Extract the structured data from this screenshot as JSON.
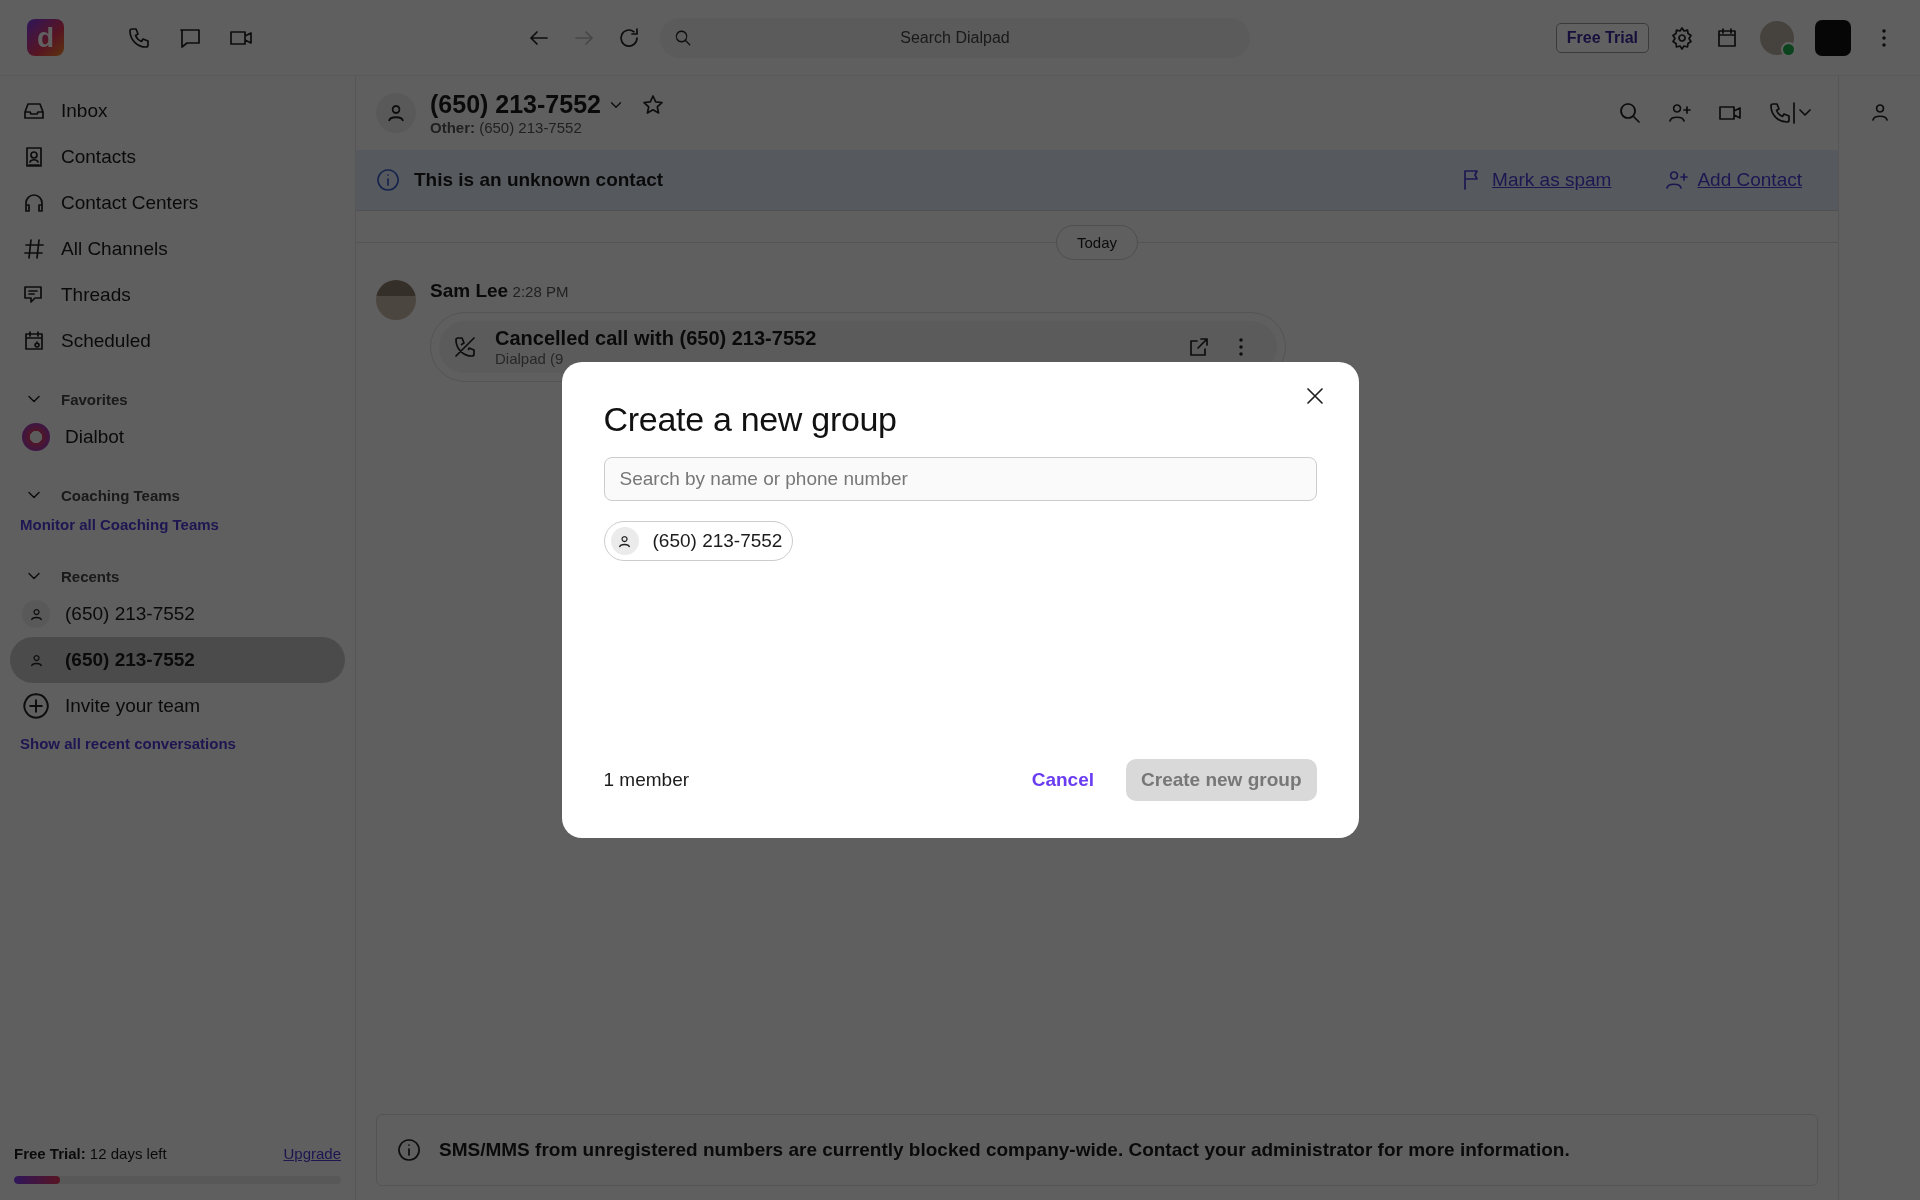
{
  "topbar": {
    "logo_letter": "d",
    "search": {
      "placeholder": "Search Dialpad"
    },
    "trial_button": "Free Trial"
  },
  "sidebar": {
    "nav": [
      {
        "label": "Inbox"
      },
      {
        "label": "Contacts"
      },
      {
        "label": "Contact Centers"
      },
      {
        "label": "All Channels"
      },
      {
        "label": "Threads"
      },
      {
        "label": "Scheduled"
      }
    ],
    "favorites": {
      "title": "Favorites",
      "expanded": true,
      "items": [
        {
          "label": "Dialbot"
        }
      ]
    },
    "coaching": {
      "title": "Coaching Teams",
      "expanded": true,
      "link": "Monitor all Coaching Teams"
    },
    "recents": {
      "title": "Recents",
      "expanded": true,
      "items": [
        {
          "label": "(650) 213-7552",
          "selected": false
        },
        {
          "label": "(650) 213-7552",
          "selected": true
        }
      ],
      "invite": "Invite your team",
      "link": "Show all recent conversations"
    },
    "trial": {
      "label": "Free Trial:",
      "remaining": "12 days left",
      "upgrade": "Upgrade",
      "level": 0.14
    }
  },
  "conversation": {
    "title": "(650) 213-7552",
    "starred": false,
    "subtitle_label": "Other:",
    "subtitle": "(650) 213-7552",
    "banner": {
      "text": "This is an unknown contact",
      "spam": "Mark as spam",
      "add": "Add Contact"
    },
    "day": "Today",
    "message": {
      "author": "Sam Lee",
      "time": "2:28 PM",
      "call_title": "Cancelled call with (650) 213-7552",
      "call_sub": "Dialpad (9"
    },
    "notice": "SMS/MMS from unregistered numbers are currently blocked company-wide. Contact your administrator for more information."
  },
  "dialog": {
    "title": "Create a new group",
    "search": {
      "placeholder": "Search by name or phone number"
    },
    "members": [
      {
        "label": "(650) 213-7552"
      }
    ],
    "count": "1 member",
    "cancel": "Cancel",
    "create": {
      "label": "Create new group",
      "disabled": true
    }
  }
}
